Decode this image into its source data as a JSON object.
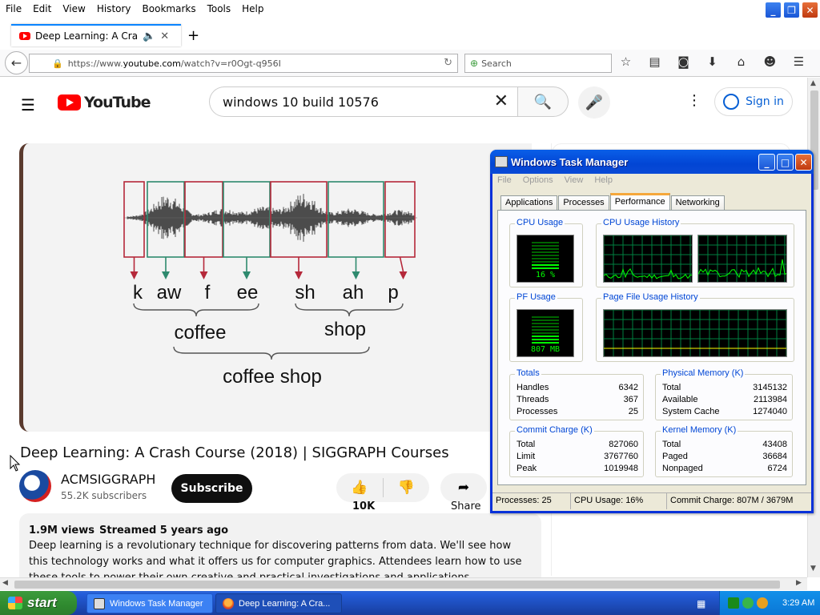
{
  "firefox": {
    "menu": [
      "File",
      "Edit",
      "View",
      "History",
      "Bookmarks",
      "Tools",
      "Help"
    ],
    "tab_title": "Deep Learning: A Crash ...",
    "url_prefix": "https://www.",
    "url_domain": "youtube.com",
    "url_path": "/watch?v=r0Ogt-q956I",
    "search_placeholder": "Search"
  },
  "youtube": {
    "logo_text": "YouTube",
    "search_value": "windows 10 build 10576",
    "signin_label": "Sign in",
    "video_title": "Deep Learning: A Crash Course (2018) | SIGGRAPH Courses",
    "channel_name": "ACMSIGGRAPH",
    "channel_subs": "55.2K subscribers",
    "subscribe_label": "Subscribe",
    "like_count": "10K",
    "share_label": "Share",
    "views": "1.9M views",
    "streamed": "Streamed 5 years ago",
    "description": "Deep learning is a revolutionary technique for discovering patterns from data. We'll see how this technology works and what it offers us for computer graphics. Attendees learn how to use these tools to power their own creative and practical investigations and applications.",
    "slide": {
      "phonemes": [
        "k",
        "aw",
        "f",
        "ee",
        "sh",
        "ah",
        "p"
      ],
      "word1": "coffee",
      "word2": "shop",
      "phrase": "coffee shop",
      "colors": {
        "red": "#b5283a",
        "green": "#2e8a6e"
      }
    }
  },
  "taskmgr": {
    "title": "Windows Task Manager",
    "menu": [
      "File",
      "Options",
      "View",
      "Help"
    ],
    "tabs": [
      "Applications",
      "Processes",
      "Performance",
      "Networking"
    ],
    "active_tab": "Performance",
    "cpu_usage_label": "CPU Usage",
    "cpu_usage_value": "16 %",
    "cpu_history_label": "CPU Usage History",
    "pf_usage_label": "PF Usage",
    "pf_usage_value": "807 MB",
    "pf_history_label": "Page File Usage History",
    "totals": {
      "label": "Totals",
      "rows": [
        {
          "k": "Handles",
          "v": "6342"
        },
        {
          "k": "Threads",
          "v": "367"
        },
        {
          "k": "Processes",
          "v": "25"
        }
      ]
    },
    "physical": {
      "label": "Physical Memory (K)",
      "rows": [
        {
          "k": "Total",
          "v": "3145132"
        },
        {
          "k": "Available",
          "v": "2113984"
        },
        {
          "k": "System Cache",
          "v": "1274040"
        }
      ]
    },
    "commit": {
      "label": "Commit Charge (K)",
      "rows": [
        {
          "k": "Total",
          "v": "827060"
        },
        {
          "k": "Limit",
          "v": "3767760"
        },
        {
          "k": "Peak",
          "v": "1019948"
        }
      ]
    },
    "kernel": {
      "label": "Kernel Memory (K)",
      "rows": [
        {
          "k": "Total",
          "v": "43408"
        },
        {
          "k": "Paged",
          "v": "36684"
        },
        {
          "k": "Nonpaged",
          "v": "6724"
        }
      ]
    },
    "status": {
      "processes": "Processes: 25",
      "cpu": "CPU Usage: 16%",
      "commit": "Commit Charge: 807M / 3679M"
    }
  },
  "taskbar": {
    "start": "start",
    "task1": "Windows Task Manager",
    "task2": "Deep Learning: A Cra...",
    "clock": "3:29 AM"
  }
}
